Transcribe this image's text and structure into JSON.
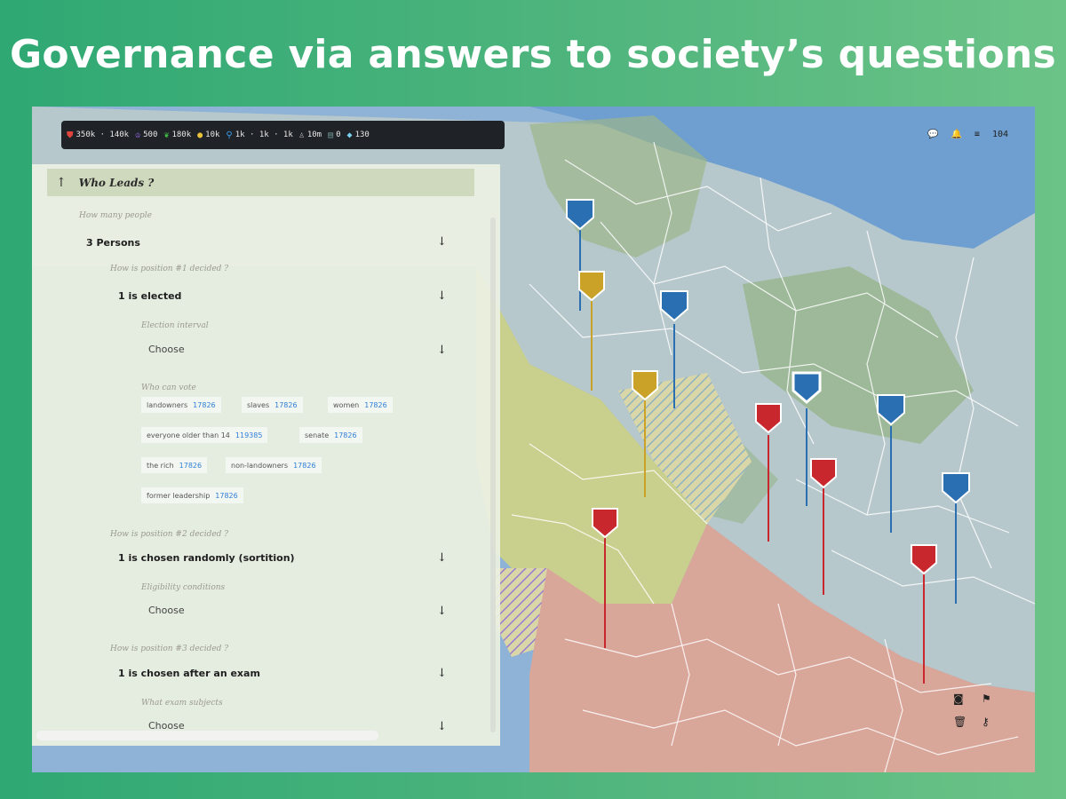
{
  "headline": "Governance via answers to society’s questions",
  "topbar": [
    {
      "icon": "shield-icon",
      "glyph": "⛊",
      "color": "#e0443c",
      "value": "350k · 140k"
    },
    {
      "icon": "crown-icon",
      "glyph": "♔",
      "color": "#9b6cf0",
      "value": "500"
    },
    {
      "icon": "leaf-icon",
      "glyph": "❦",
      "color": "#3fbf4a",
      "value": "180k"
    },
    {
      "icon": "coin-icon",
      "glyph": "●",
      "color": "#e8c23a",
      "value": "10k"
    },
    {
      "icon": "pin-icon",
      "glyph": "⚲",
      "color": "#3a9ae8",
      "value": "1k · 1k · 1k"
    },
    {
      "icon": "person-icon",
      "glyph": "♙",
      "color": "#bbbbbb",
      "value": "10m"
    },
    {
      "icon": "book-icon",
      "glyph": "▤",
      "color": "#6a8a8a",
      "value": "0"
    },
    {
      "icon": "gem-icon",
      "glyph": "◆",
      "color": "#7ad0f0",
      "value": "130"
    }
  ],
  "top_right": {
    "value": "104"
  },
  "panel": {
    "title": "Who Leads ?",
    "how_many_q": "How many people",
    "how_many_a": "3 Persons",
    "pos1_q": "How is position #1 decided ?",
    "pos1_a": "1 is elected",
    "interval_q": "Election interval",
    "interval_a": "Choose",
    "vote_q": "Who can vote",
    "voters": [
      {
        "label": "landowners",
        "count": "17826"
      },
      {
        "label": "slaves",
        "count": "17826"
      },
      {
        "label": "women",
        "count": "17826"
      },
      {
        "label": "everyone older than 14",
        "count": "119385"
      },
      {
        "label": "senate",
        "count": "17826"
      },
      {
        "label": "the rich",
        "count": "17826"
      },
      {
        "label": "non-landowners",
        "count": "17826"
      },
      {
        "label": "former leadership",
        "count": "17826"
      }
    ],
    "pos2_q": "How is position #2 decided ?",
    "pos2_a": "1 is chosen randomly (sortition)",
    "elig_q": "Eligibility conditions",
    "elig_a": "Choose",
    "pos3_q": "How is position #3 decided ?",
    "pos3_a": "1 is chosen after an exam",
    "exam_q": "What exam subjects",
    "exam_a": "Choose"
  },
  "colors": {
    "red_faction": "#c8282d",
    "blue_faction": "#2a6fb2",
    "yellow_faction": "#c9a227"
  }
}
